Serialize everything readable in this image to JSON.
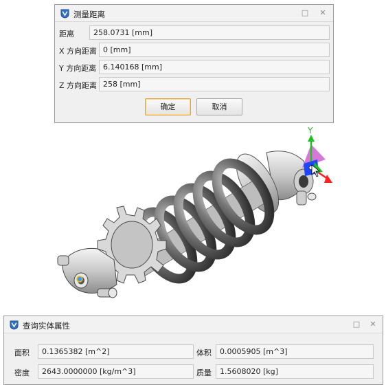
{
  "measure_dialog": {
    "title": "测量距离",
    "rows": [
      {
        "label": "距离",
        "value": "258.0731  [mm]"
      },
      {
        "label": "X 方向距离",
        "value": "0  [mm]"
      },
      {
        "label": "Y 方向距离",
        "value": "6.140168  [mm]"
      },
      {
        "label": "Z 方向距离",
        "value": "258  [mm]"
      }
    ],
    "ok_label": "确定",
    "cancel_label": "取消",
    "pin_glyph": "□",
    "close_glyph": "✕"
  },
  "viewport": {
    "axis_y_label": "Y",
    "colors": {
      "axis_y": "#20c020",
      "axis_x": "#ff2020",
      "axis_z": "#1c46ff",
      "plane": "#d060d0",
      "spring": "#6d6d6d",
      "body": "#d4d4d4"
    }
  },
  "properties_dialog": {
    "title": "查询实体属性",
    "fields": [
      {
        "label": "面积",
        "value": "0.1365382 [m^2]"
      },
      {
        "label": "体积",
        "value": "0.0005905 [m^3]"
      },
      {
        "label": "密度",
        "value": "2643.0000000 [kg/m^3]"
      },
      {
        "label": "质量",
        "value": "1.5608020 [kg]"
      }
    ],
    "pin_glyph": "□",
    "close_glyph": "✕"
  }
}
